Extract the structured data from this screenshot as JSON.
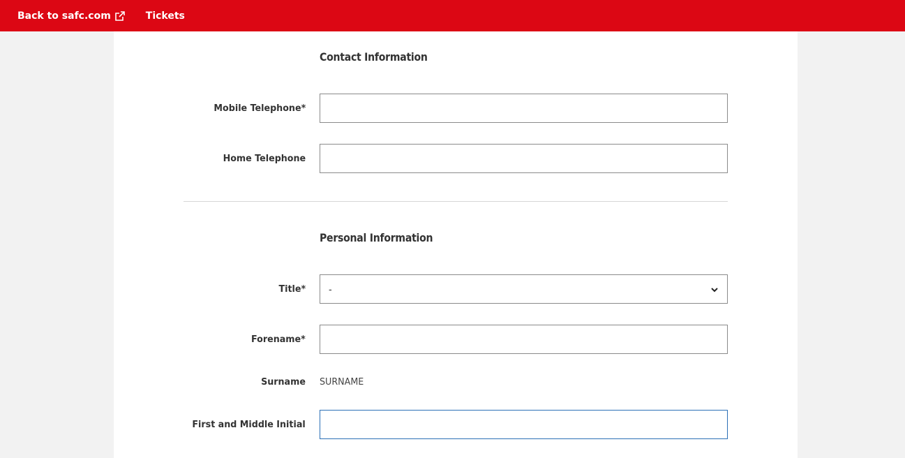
{
  "topbar": {
    "back_label": "Back to safc.com",
    "back_icon": "external-link-icon",
    "tickets_label": "Tickets",
    "bg_color": "#dc0714"
  },
  "contact": {
    "title": "Contact Information",
    "mobile_label": "Mobile Telephone*",
    "mobile_value": "",
    "home_label": "Home Telephone",
    "home_value": ""
  },
  "personal": {
    "title": "Personal Information",
    "title_label": "Title*",
    "title_selected": "-",
    "forename_label": "Forename*",
    "forename_value": "",
    "surname_label": "Surname",
    "surname_value": "SURNAME",
    "initials_label": "First and Middle Initial",
    "initials_value": ""
  }
}
